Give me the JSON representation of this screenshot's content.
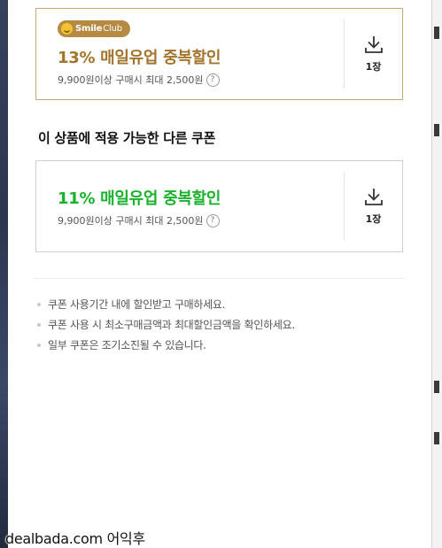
{
  "coupons_top": {
    "badge_brand": "Smile",
    "badge_club": "Club",
    "title": "13% 매일유업 중복할인",
    "condition": "9,900원이상 구매시 최대 2,500원",
    "help_glyph": "?",
    "download_count": "1장",
    "title_color": "#a3742c"
  },
  "section": {
    "title": "이 상품에 적용 가능한 다른 쿠폰"
  },
  "coupons_other": {
    "title": "11% 매일유업 중복할인",
    "condition": "9,900원이상 구매시 최대 2,500원",
    "help_glyph": "?",
    "download_count": "1장",
    "title_color": "#18b22c"
  },
  "notices": [
    "쿠폰 사용기간 내에 할인받고 구매하세요.",
    "쿠폰 사용 시 최소구매금액과 최대할인금액을 확인하세요.",
    "일부 쿠폰은 조기소진될 수 있습니다."
  ],
  "watermark": "dealbada.com 어익후",
  "icons": {
    "download": "download-icon",
    "help": "help-icon",
    "smile": "smile-icon"
  }
}
